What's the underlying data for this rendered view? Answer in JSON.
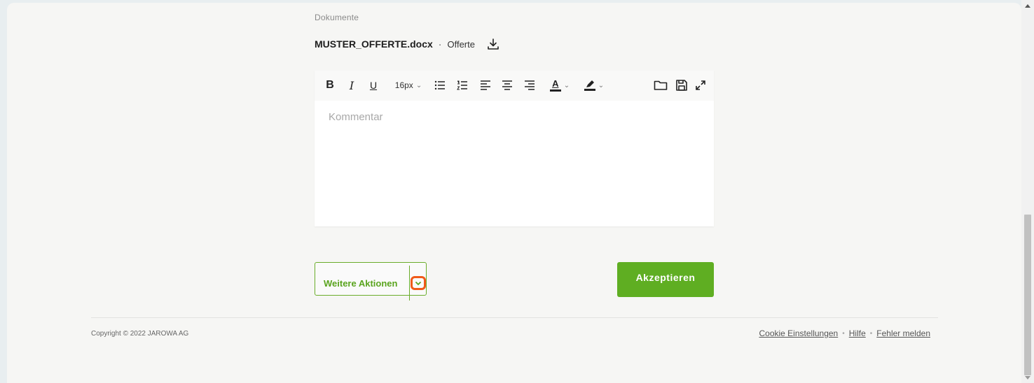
{
  "documents": {
    "section_label": "Dokumente",
    "file_name": "MUSTER_OFFERTE.docx",
    "separator": "·",
    "file_type": "Offerte",
    "download_icon": "download-icon"
  },
  "editor": {
    "placeholder": "Kommentar",
    "toolbar": {
      "bold": "B",
      "italic": "I",
      "underline": "U",
      "font_size": "16px",
      "text_color_glyph": "A",
      "icons": [
        "bullet-list-icon",
        "numbered-list-icon",
        "align-left-icon",
        "align-center-icon",
        "align-right-icon",
        "text-color-icon",
        "highlight-icon",
        "folder-icon",
        "save-icon",
        "fullscreen-icon"
      ]
    }
  },
  "actions": {
    "more_label": "Weitere Aktionen",
    "accept_label": "Akzeptieren",
    "accent_color": "#5fae22",
    "highlight_color": "#f05a1a"
  },
  "footer": {
    "copyright": "Copyright © 2022 JAROWA AG",
    "links": [
      "Cookie Einstellungen",
      "Hilfe",
      "Fehler melden"
    ]
  }
}
